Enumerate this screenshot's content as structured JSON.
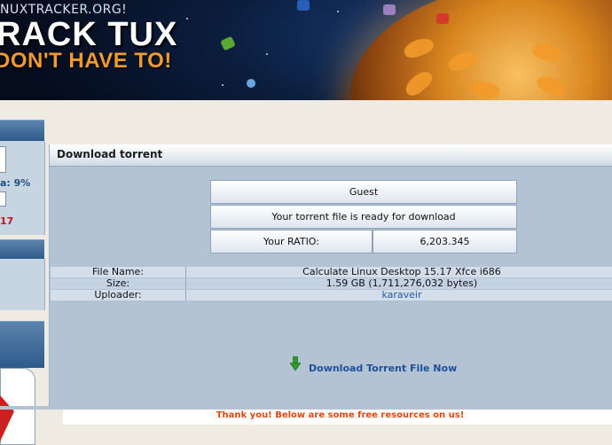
{
  "header": {
    "site_url": "NUXTRACKER.ORG!",
    "slogan_line1": "RACK TUX",
    "slogan_line2": "DON'T HAVE TO!"
  },
  "sidebar": {
    "ratio_label": "a: 9%",
    "number_value": "17"
  },
  "panel": {
    "title": "Download torrent",
    "user_status": "Guest",
    "ready_message": "Your torrent file is ready for download",
    "ratio_label": "Your RATIO:",
    "ratio_value": "6,203.345"
  },
  "file_info": {
    "rows": [
      {
        "label": "File Name:",
        "value": "Calculate Linux Desktop 15.17 Xfce i686"
      },
      {
        "label": "Size:",
        "value": "1.59 GB (1,711,276,032 bytes)"
      },
      {
        "label": "Uploader:",
        "value": "karaveir"
      }
    ]
  },
  "download": {
    "link_text": "Download Torrent File Now",
    "icon": "download-arrow-icon",
    "icon_color": "#2e9a2a"
  },
  "thanks_message": "Thank you! Below are some free resources on us!",
  "colors": {
    "accent_blue": "#1f4f9a",
    "link_blue": "#1f5aa6",
    "thanks_orange": "#e0470c",
    "ratio_sidebar_blue": "#1f4f82",
    "alert_red": "#c0151b"
  }
}
